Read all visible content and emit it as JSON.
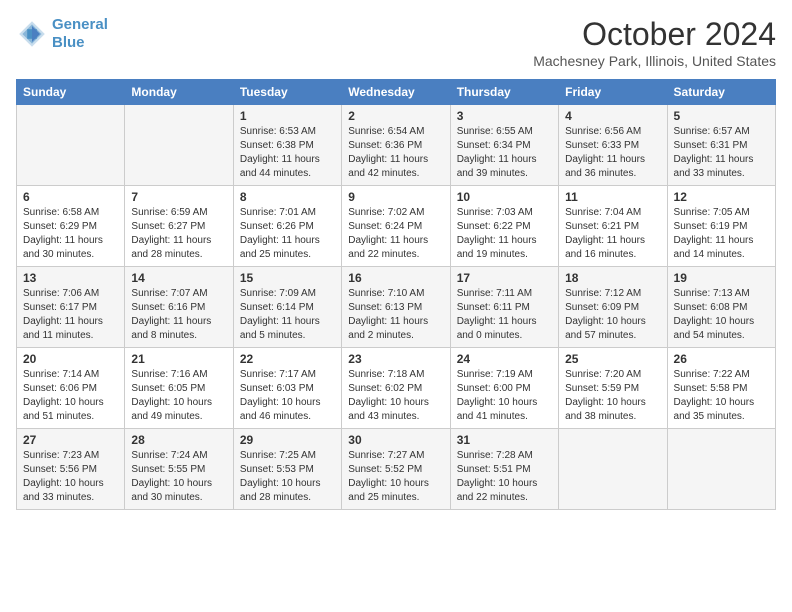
{
  "header": {
    "logo_line1": "General",
    "logo_line2": "Blue",
    "month_title": "October 2024",
    "location": "Machesney Park, Illinois, United States"
  },
  "days_of_week": [
    "Sunday",
    "Monday",
    "Tuesday",
    "Wednesday",
    "Thursday",
    "Friday",
    "Saturday"
  ],
  "weeks": [
    [
      {
        "day": "",
        "sunrise": "",
        "sunset": "",
        "daylight": ""
      },
      {
        "day": "",
        "sunrise": "",
        "sunset": "",
        "daylight": ""
      },
      {
        "day": "1",
        "sunrise": "Sunrise: 6:53 AM",
        "sunset": "Sunset: 6:38 PM",
        "daylight": "Daylight: 11 hours and 44 minutes."
      },
      {
        "day": "2",
        "sunrise": "Sunrise: 6:54 AM",
        "sunset": "Sunset: 6:36 PM",
        "daylight": "Daylight: 11 hours and 42 minutes."
      },
      {
        "day": "3",
        "sunrise": "Sunrise: 6:55 AM",
        "sunset": "Sunset: 6:34 PM",
        "daylight": "Daylight: 11 hours and 39 minutes."
      },
      {
        "day": "4",
        "sunrise": "Sunrise: 6:56 AM",
        "sunset": "Sunset: 6:33 PM",
        "daylight": "Daylight: 11 hours and 36 minutes."
      },
      {
        "day": "5",
        "sunrise": "Sunrise: 6:57 AM",
        "sunset": "Sunset: 6:31 PM",
        "daylight": "Daylight: 11 hours and 33 minutes."
      }
    ],
    [
      {
        "day": "6",
        "sunrise": "Sunrise: 6:58 AM",
        "sunset": "Sunset: 6:29 PM",
        "daylight": "Daylight: 11 hours and 30 minutes."
      },
      {
        "day": "7",
        "sunrise": "Sunrise: 6:59 AM",
        "sunset": "Sunset: 6:27 PM",
        "daylight": "Daylight: 11 hours and 28 minutes."
      },
      {
        "day": "8",
        "sunrise": "Sunrise: 7:01 AM",
        "sunset": "Sunset: 6:26 PM",
        "daylight": "Daylight: 11 hours and 25 minutes."
      },
      {
        "day": "9",
        "sunrise": "Sunrise: 7:02 AM",
        "sunset": "Sunset: 6:24 PM",
        "daylight": "Daylight: 11 hours and 22 minutes."
      },
      {
        "day": "10",
        "sunrise": "Sunrise: 7:03 AM",
        "sunset": "Sunset: 6:22 PM",
        "daylight": "Daylight: 11 hours and 19 minutes."
      },
      {
        "day": "11",
        "sunrise": "Sunrise: 7:04 AM",
        "sunset": "Sunset: 6:21 PM",
        "daylight": "Daylight: 11 hours and 16 minutes."
      },
      {
        "day": "12",
        "sunrise": "Sunrise: 7:05 AM",
        "sunset": "Sunset: 6:19 PM",
        "daylight": "Daylight: 11 hours and 14 minutes."
      }
    ],
    [
      {
        "day": "13",
        "sunrise": "Sunrise: 7:06 AM",
        "sunset": "Sunset: 6:17 PM",
        "daylight": "Daylight: 11 hours and 11 minutes."
      },
      {
        "day": "14",
        "sunrise": "Sunrise: 7:07 AM",
        "sunset": "Sunset: 6:16 PM",
        "daylight": "Daylight: 11 hours and 8 minutes."
      },
      {
        "day": "15",
        "sunrise": "Sunrise: 7:09 AM",
        "sunset": "Sunset: 6:14 PM",
        "daylight": "Daylight: 11 hours and 5 minutes."
      },
      {
        "day": "16",
        "sunrise": "Sunrise: 7:10 AM",
        "sunset": "Sunset: 6:13 PM",
        "daylight": "Daylight: 11 hours and 2 minutes."
      },
      {
        "day": "17",
        "sunrise": "Sunrise: 7:11 AM",
        "sunset": "Sunset: 6:11 PM",
        "daylight": "Daylight: 11 hours and 0 minutes."
      },
      {
        "day": "18",
        "sunrise": "Sunrise: 7:12 AM",
        "sunset": "Sunset: 6:09 PM",
        "daylight": "Daylight: 10 hours and 57 minutes."
      },
      {
        "day": "19",
        "sunrise": "Sunrise: 7:13 AM",
        "sunset": "Sunset: 6:08 PM",
        "daylight": "Daylight: 10 hours and 54 minutes."
      }
    ],
    [
      {
        "day": "20",
        "sunrise": "Sunrise: 7:14 AM",
        "sunset": "Sunset: 6:06 PM",
        "daylight": "Daylight: 10 hours and 51 minutes."
      },
      {
        "day": "21",
        "sunrise": "Sunrise: 7:16 AM",
        "sunset": "Sunset: 6:05 PM",
        "daylight": "Daylight: 10 hours and 49 minutes."
      },
      {
        "day": "22",
        "sunrise": "Sunrise: 7:17 AM",
        "sunset": "Sunset: 6:03 PM",
        "daylight": "Daylight: 10 hours and 46 minutes."
      },
      {
        "day": "23",
        "sunrise": "Sunrise: 7:18 AM",
        "sunset": "Sunset: 6:02 PM",
        "daylight": "Daylight: 10 hours and 43 minutes."
      },
      {
        "day": "24",
        "sunrise": "Sunrise: 7:19 AM",
        "sunset": "Sunset: 6:00 PM",
        "daylight": "Daylight: 10 hours and 41 minutes."
      },
      {
        "day": "25",
        "sunrise": "Sunrise: 7:20 AM",
        "sunset": "Sunset: 5:59 PM",
        "daylight": "Daylight: 10 hours and 38 minutes."
      },
      {
        "day": "26",
        "sunrise": "Sunrise: 7:22 AM",
        "sunset": "Sunset: 5:58 PM",
        "daylight": "Daylight: 10 hours and 35 minutes."
      }
    ],
    [
      {
        "day": "27",
        "sunrise": "Sunrise: 7:23 AM",
        "sunset": "Sunset: 5:56 PM",
        "daylight": "Daylight: 10 hours and 33 minutes."
      },
      {
        "day": "28",
        "sunrise": "Sunrise: 7:24 AM",
        "sunset": "Sunset: 5:55 PM",
        "daylight": "Daylight: 10 hours and 30 minutes."
      },
      {
        "day": "29",
        "sunrise": "Sunrise: 7:25 AM",
        "sunset": "Sunset: 5:53 PM",
        "daylight": "Daylight: 10 hours and 28 minutes."
      },
      {
        "day": "30",
        "sunrise": "Sunrise: 7:27 AM",
        "sunset": "Sunset: 5:52 PM",
        "daylight": "Daylight: 10 hours and 25 minutes."
      },
      {
        "day": "31",
        "sunrise": "Sunrise: 7:28 AM",
        "sunset": "Sunset: 5:51 PM",
        "daylight": "Daylight: 10 hours and 22 minutes."
      },
      {
        "day": "",
        "sunrise": "",
        "sunset": "",
        "daylight": ""
      },
      {
        "day": "",
        "sunrise": "",
        "sunset": "",
        "daylight": ""
      }
    ]
  ]
}
